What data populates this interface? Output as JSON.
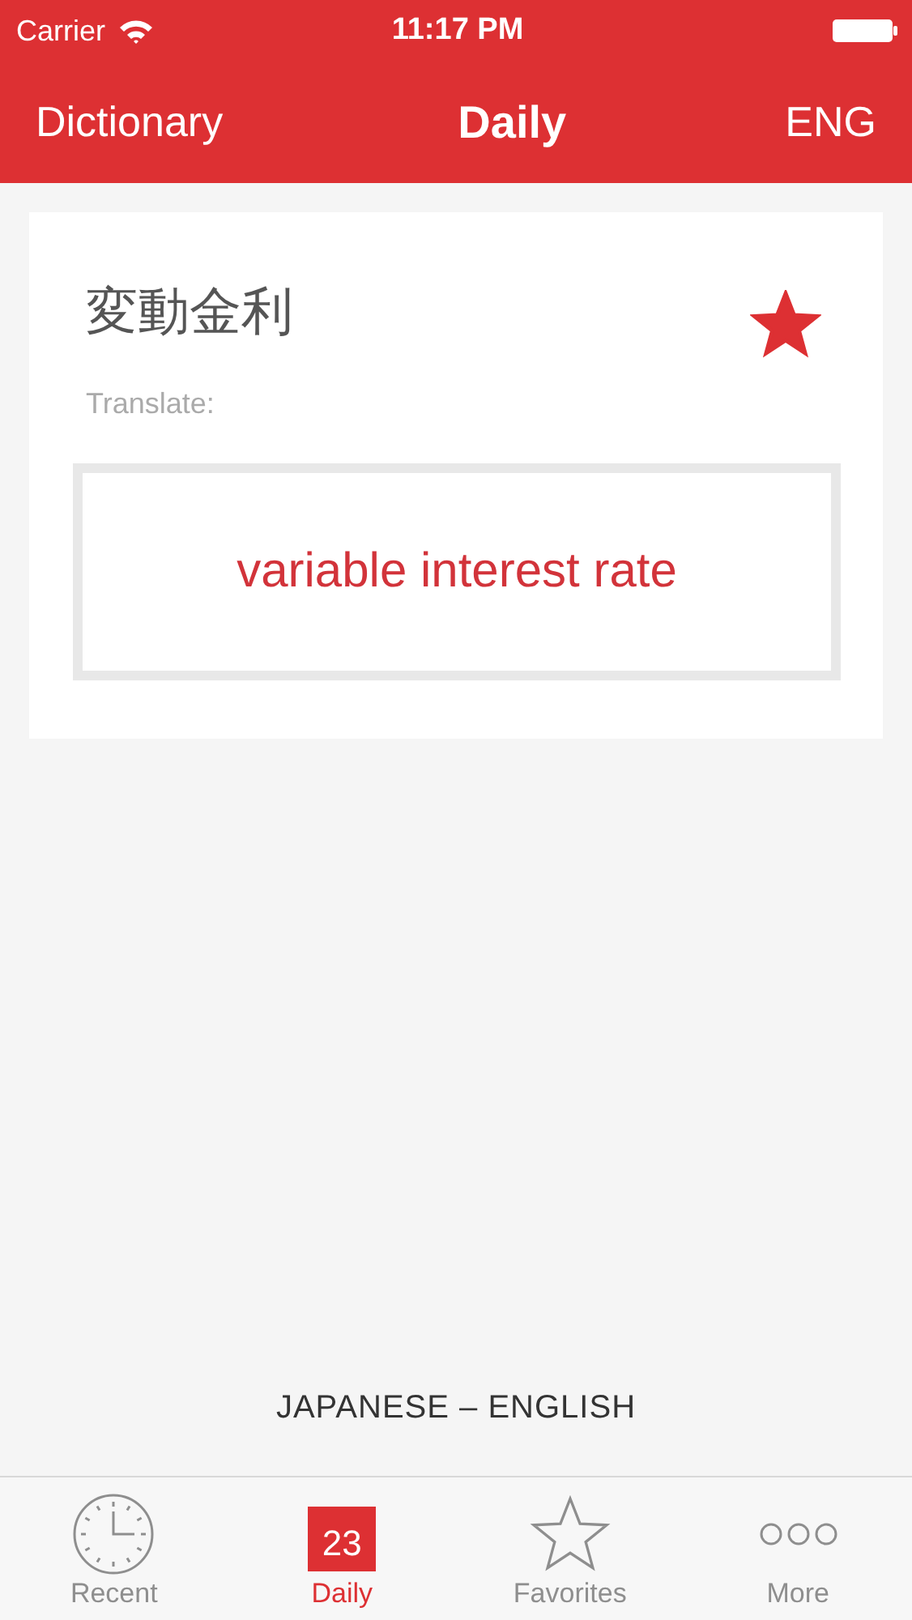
{
  "status_bar": {
    "carrier": "Carrier",
    "time": "11:17 PM"
  },
  "nav_bar": {
    "left": "Dictionary",
    "title": "Daily",
    "right": "ENG"
  },
  "card": {
    "word": "変動金利",
    "favorite": true,
    "translate_label": "Translate:",
    "translation": "variable interest rate"
  },
  "language_pair": "JAPANESE – ENGLISH",
  "tabs": [
    {
      "kind": "clock",
      "label": "Recent",
      "selected": false
    },
    {
      "kind": "calendar",
      "label": "Daily",
      "badge": "23",
      "selected": true
    },
    {
      "kind": "star",
      "label": "Favorites",
      "selected": false
    },
    {
      "kind": "dots",
      "label": "More",
      "selected": false
    }
  ]
}
